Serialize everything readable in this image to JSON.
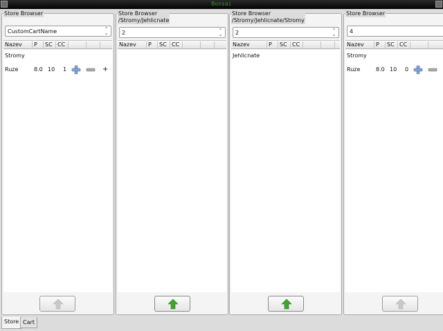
{
  "window": {
    "title": "Bonsai"
  },
  "panels": [
    {
      "legend": "Store Browser",
      "path": "",
      "combo_value": "CustomCartName",
      "columns": [
        "Nazev",
        "P",
        "SC",
        "CC"
      ],
      "category": "Stromy",
      "item": {
        "name": "Ruze",
        "p": "8.0",
        "sc": "10",
        "cc": "1",
        "extra": "+"
      },
      "up_enabled": false
    },
    {
      "legend": "Store Browser",
      "path": "/Stromy/Jehlicnate",
      "combo_value": "2",
      "columns": [
        "Nazev",
        "P",
        "SC",
        "CC"
      ],
      "up_enabled": true
    },
    {
      "legend": "Store Browser",
      "path": "/Stromy/Jehlicnate/Stromy",
      "combo_value": "2",
      "columns": [
        "Nazev",
        "P",
        "SC",
        "CC"
      ],
      "category": "Jehlicnate",
      "up_enabled": true
    },
    {
      "legend": "Store Browser",
      "path": "",
      "combo_value": "4",
      "columns": [
        "Nazev",
        "P",
        "SC",
        "CC"
      ],
      "category": "Stromy",
      "item": {
        "name": "Ruze",
        "p": "8.0",
        "sc": "10",
        "cc": "0"
      },
      "up_enabled": false
    }
  ],
  "tabs": [
    {
      "label": "Store",
      "active": true
    },
    {
      "label": "Cart",
      "active": false
    }
  ],
  "icons": {
    "plus": "plus-icon",
    "minus": "minus-icon",
    "up_arrow": "up-arrow-icon",
    "combo_arrows": "updown-arrows-icon"
  },
  "colors": {
    "title_text": "#3a8a3a",
    "arrow_enabled": "#3fa52b",
    "arrow_disabled": "#c8c8c8",
    "plus_blue": "#7ea6d8"
  }
}
